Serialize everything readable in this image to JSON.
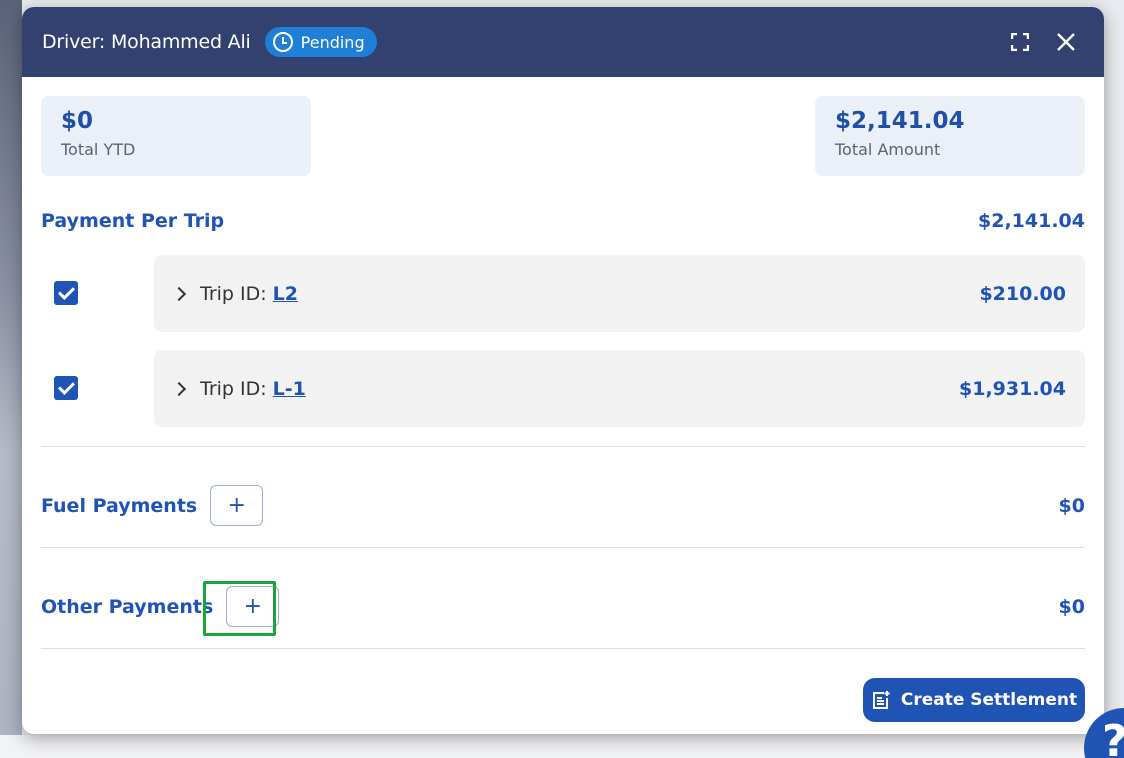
{
  "header": {
    "title": "Driver: Mohammed Ali",
    "status": "Pending"
  },
  "summary": {
    "ytd_amount": "$0",
    "ytd_label": "Total YTD",
    "total_amount": "$2,141.04",
    "total_label": "Total Amount"
  },
  "payment_per_trip": {
    "title": "Payment Per Trip",
    "amount": "$2,141.04",
    "trips": [
      {
        "label": "Trip ID:",
        "id": "L2",
        "amount": "$210.00",
        "checked": true
      },
      {
        "label": "Trip ID:",
        "id": "L-1",
        "amount": "$1,931.04",
        "checked": true
      }
    ]
  },
  "fuel_payments": {
    "title": "Fuel Payments",
    "add_label": "+",
    "amount": "$0"
  },
  "other_payments": {
    "title": "Other Payments",
    "add_label": "+",
    "amount": "$0"
  },
  "actions": {
    "create_settlement": "Create Settlement",
    "help": "?"
  },
  "colors": {
    "header_bg": "#334170",
    "accent": "#1f54b4",
    "badge": "#1f7fd7",
    "highlight": "#1aa53a"
  },
  "icons": [
    "clock-icon",
    "expand-icon",
    "close-icon",
    "chevron-right-icon",
    "checkbox-checked-icon",
    "document-add-icon"
  ]
}
